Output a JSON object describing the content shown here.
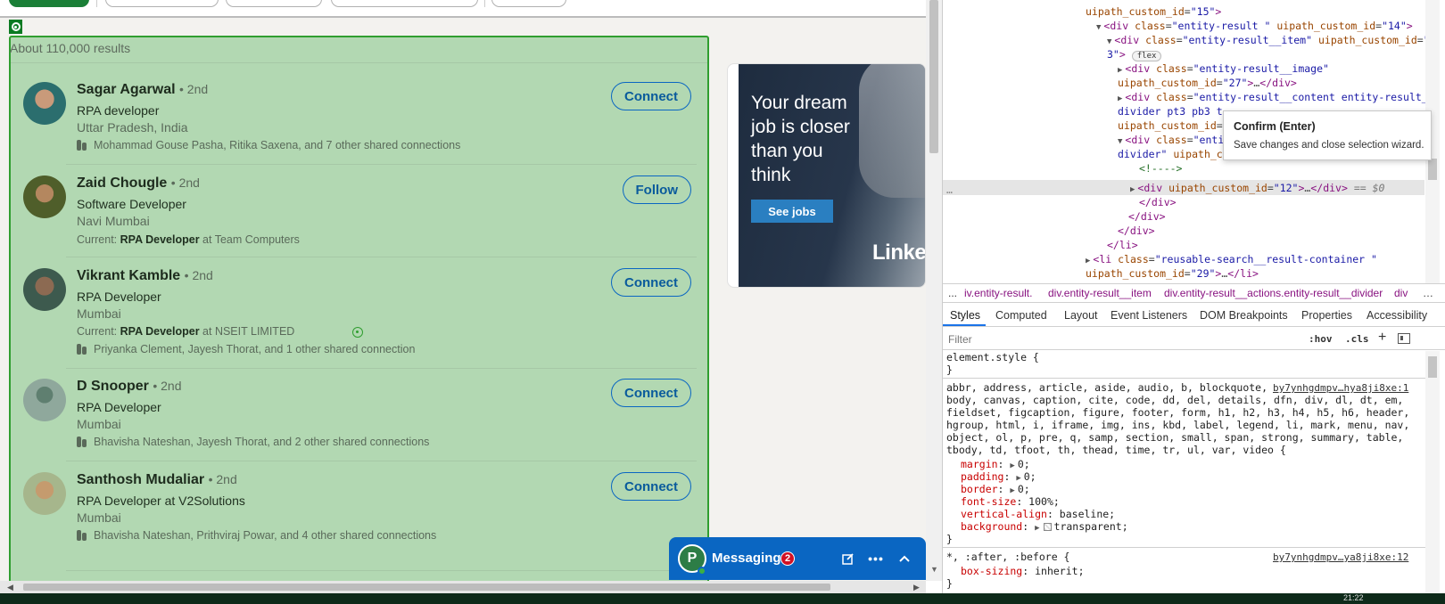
{
  "search": {
    "results_count": "About 110,000 results"
  },
  "results": [
    {
      "name": "Sagar Agarwal",
      "degree": "• 2nd",
      "headline": "RPA developer",
      "location": "Uttar Pradesh, India",
      "current_prefix": "",
      "current_role": "",
      "current_suffix": "",
      "shared": "Mohammad Gouse Pasha, Ritika Saxena, and 7 other shared connections",
      "action": "Connect"
    },
    {
      "name": "Zaid Chougle",
      "degree": "• 2nd",
      "headline": "Software Developer",
      "location": "Navi Mumbai",
      "current_prefix": "Current:",
      "current_role": "RPA Developer",
      "current_suffix": "at Team Computers",
      "shared": "",
      "action": "Follow"
    },
    {
      "name": "Vikrant Kamble",
      "degree": "• 2nd",
      "headline": "RPA Developer",
      "location": "Mumbai",
      "current_prefix": "Current:",
      "current_role": "RPA Developer",
      "current_suffix": "at NSEIT LIMITED",
      "shared": "Priyanka Clement, Jayesh Thorat, and 1 other shared connection",
      "action": "Connect"
    },
    {
      "name": "D Snooper",
      "degree": "• 2nd",
      "headline": "RPA Developer",
      "location": "Mumbai",
      "current_prefix": "",
      "current_role": "",
      "current_suffix": "",
      "shared": "Bhavisha Nateshan, Jayesh Thorat, and 2 other shared connections",
      "action": "Connect"
    },
    {
      "name": "Santhosh Mudaliar",
      "degree": "• 2nd",
      "headline": "RPA Developer at V2Solutions",
      "location": "Mumbai",
      "current_prefix": "",
      "current_role": "",
      "current_suffix": "",
      "shared": "Bhavisha Nateshan, Prithviraj Powar, and 4 other shared connections",
      "action": "Connect"
    }
  ],
  "ad": {
    "headline": "Your dream job is closer than you think",
    "cta": "See jobs",
    "logo_text": "Linke"
  },
  "messaging": {
    "avatar_letter": "P",
    "title": "Messaging",
    "unread": "2",
    "icons": [
      "compose-icon",
      "more-icon",
      "chevron-up-icon"
    ]
  },
  "devtools": {
    "dom_lines": [
      {
        "indent": 0,
        "text": "uipath_custom_id=\"15\">"
      },
      {
        "indent": 1,
        "text": "<div class=\"entity-result  \" uipath_custom_id=\"14\">"
      },
      {
        "indent": 2,
        "text": "<div class=\"entity-result__item\" uipath_custom_id=\"1"
      },
      {
        "indent": 3,
        "text": "3\">"
      },
      {
        "indent": 4,
        "text": "<div class=\"entity-result__image\""
      },
      {
        "indent": 5,
        "text": "uipath_custom_id=\"27\">…</div>"
      },
      {
        "indent": 4,
        "text": "<div class=\"entity-result__content entity-result__"
      },
      {
        "indent": 5,
        "text": "divider pt3 pb3 t-"
      },
      {
        "indent": 5,
        "text": "uipath_custom_id=\""
      },
      {
        "indent": 4,
        "text": "<div class=\"entit"
      },
      {
        "indent": 5,
        "text": "divider\" uipath_cu"
      },
      {
        "indent": 6,
        "text": "<!---->"
      },
      {
        "indent": 6,
        "text": "<div uipath_custom_id=\"12\">…</div> == $0"
      },
      {
        "indent": 5,
        "text": "</div>"
      },
      {
        "indent": 4,
        "text": "</div>"
      },
      {
        "indent": 3,
        "text": "</div>"
      },
      {
        "indent": 2,
        "text": "</li>"
      },
      {
        "indent": 1,
        "text": "<li class=\"reusable-search__result-container \""
      },
      {
        "indent": 0,
        "text": "uipath_custom_id=\"29\">…</li>"
      }
    ],
    "flex_badge": "flex",
    "selected_suffix": "== $0",
    "tooltip": {
      "title": "Confirm (Enter)",
      "description": "Save changes and close selection wizard."
    },
    "breadcrumbs": [
      "...",
      "iv.entity-result.",
      "div.entity-result__item",
      "div.entity-result__actions.entity-result__divider",
      "div"
    ],
    "tabs": [
      "Styles",
      "Computed",
      "Layout",
      "Event Listeners",
      "DOM Breakpoints",
      "Properties",
      "Accessibility"
    ],
    "filter_placeholder": "Filter",
    "hov": ":hov",
    "cls": ".cls",
    "styles": {
      "element_style": "element.style {",
      "close_brace": "}",
      "reset_selectors": [
        "abbr, address, article, aside, audio, b, blockquote,",
        "body, canvas, caption, cite, code, dd, del, details, dfn, div, dl, dt, em,",
        "fieldset, figcaption, figure, footer, form, h1, h2, h3, h4, h5, h6, header,",
        "hgroup, html, i, iframe, img, ins, kbd, label, legend, li, mark, menu, nav,",
        "object, ol, p, pre, q, samp, section, small, span, strong, summary, table,",
        "tbody, td, tfoot, th, thead, time, tr, ul, var, video {"
      ],
      "reset_source": "by7ynhgdmpv…hya8ji8xe:1",
      "reset_props": [
        {
          "name": "margin",
          "value": "0;",
          "expand": true
        },
        {
          "name": "padding",
          "value": "0;",
          "expand": true
        },
        {
          "name": "border",
          "value": "0;",
          "expand": true
        },
        {
          "name": "font-size",
          "value": "100%;",
          "expand": false
        },
        {
          "name": "vertical-align",
          "value": "baseline;",
          "expand": false
        },
        {
          "name": "background",
          "value": "transparent;",
          "expand": true
        }
      ],
      "universal_selector": "*, :after, :before {",
      "universal_source": "by7ynhgdmpv…ya8ji8xe:12",
      "universal_props": [
        {
          "name": "box-sizing",
          "value": "inherit;"
        }
      ]
    }
  },
  "taskbar": {
    "clock": "21:22"
  },
  "colors": {
    "highlight_fill": "#b2d8b2",
    "highlight_border": "#2f9e2f",
    "linkedin_blue": "#0a66c2",
    "devtools_tag": "#881280",
    "devtools_attr": "#994500",
    "devtools_value": "#1a1aa6",
    "css_property": "#c80000"
  }
}
